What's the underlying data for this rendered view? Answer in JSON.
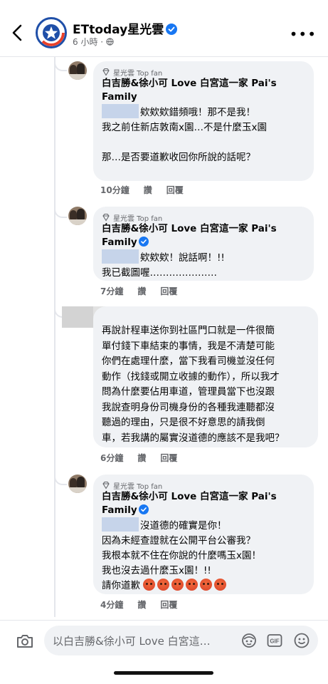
{
  "header": {
    "page_name": "ETtoday星光雲",
    "meta_time": "6 小時 ·",
    "more": "•••"
  },
  "comments": [
    {
      "badge": "星光雲 Top fan",
      "author": "白吉勝&徐小可 Love 白宮這一家 Pai's Family",
      "line1": "欸欸欸錯頻哦！那不是我！",
      "rest": "\n我之前住新店敦南x園…不是什麼玉x園\n\n那…是否要道歉收回你所說的話呢？",
      "time": "10分鐘",
      "like": "讚",
      "reply": "回覆"
    },
    {
      "badge": "星光雲 Top fan",
      "author": "白吉勝&徐小可 Love 白宮這一家 Pai's Family",
      "line1": "欸欸欸！說話啊！!!",
      "rest": "我已截圖喔…………………",
      "time": "7分鐘",
      "like": "讚",
      "reply": "回覆"
    },
    {
      "body": "再說計程車送你到社區門口就是一件很簡\n單付錢下車結束的事情，我是不清楚可能\n你們在處理什麼，當下我看司機並沒任何\n動作（找錢或開立收據的動作），所以我才\n問為什麼要佔用車道，管理員當下也沒跟\n我說查明身份司機身份的各種我連聽都沒\n聽過的理由，只是很不好意思的請我倒\n車，若我講的屬實沒道德的應該不是我吧？",
      "time": "6分鐘",
      "like": "讚",
      "reply": "回覆"
    },
    {
      "badge": "星光雲 Top fan",
      "author": "白吉勝&徐小可 Love 白宮這一家 Pai's Family",
      "line1": "沒道德的確實是你！",
      "rest": "因為未經查證就在公開平台公審我？\n我根本就不住在你說的什麼嗎玉x園！\n我也沒去過什麼玉x園！!!",
      "last_line": "請你道歉",
      "emojis": [
        "angry-emoji",
        "angry-emoji",
        "angry-emoji",
        "angry-emoji",
        "angry-emoji",
        "angry-emoji"
      ],
      "time": "4分鐘",
      "like": "讚",
      "reply": "回覆"
    }
  ],
  "composer": {
    "placeholder": "以白吉勝&徐小可 Love 白宮這…",
    "icons": [
      "camera-icon",
      "avatar-sticker-icon",
      "gif-icon",
      "emoji-icon"
    ]
  },
  "colors": {
    "bubble": "#f0f2f5",
    "verified": "#1877f2",
    "meta": "#65676b",
    "angry": "#e0502e"
  }
}
